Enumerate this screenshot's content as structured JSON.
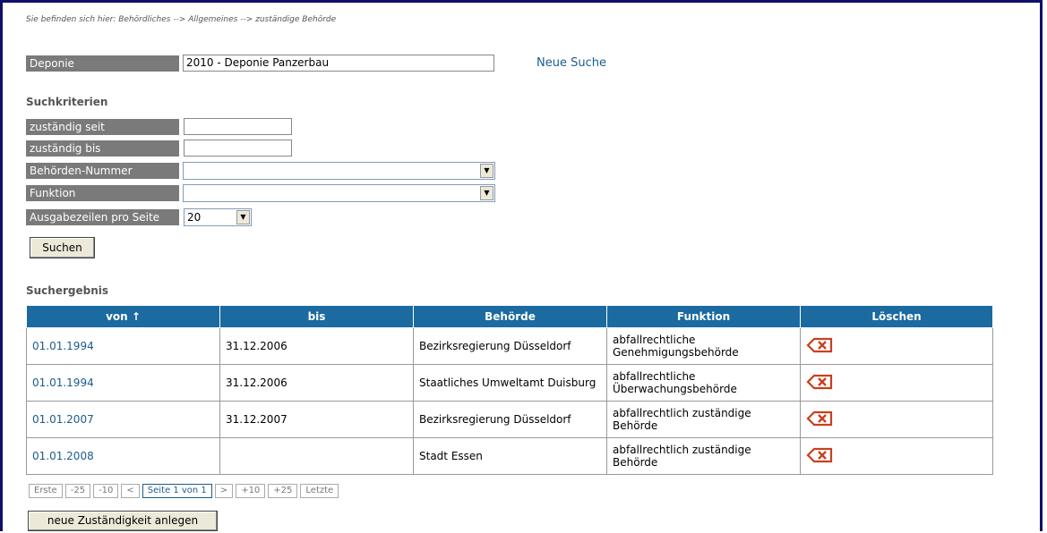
{
  "breadcrumb": "Sie befinden sich hier: Behördliches --> Allgemeines --> zuständige Behörde",
  "deponie": {
    "label": "Deponie",
    "value": "2010 - Deponie Panzerbau",
    "neue_suche": "Neue Suche"
  },
  "suchkriterien": {
    "heading": "Suchkriterien",
    "zustaendig_seit": {
      "label": "zuständig seit",
      "value": ""
    },
    "zustaendig_bis": {
      "label": "zuständig bis",
      "value": ""
    },
    "behoerden_nummer": {
      "label": "Behörden-Nummer",
      "value": ""
    },
    "funktion": {
      "label": "Funktion",
      "value": ""
    },
    "ausgabezeilen": {
      "label": "Ausgabezeilen pro Seite",
      "value": "20"
    },
    "suchen_button": "Suchen"
  },
  "suchergebnis": {
    "heading": "Suchergebnis",
    "columns": [
      "von ↑",
      "bis",
      "Behörde",
      "Funktion",
      "Löschen"
    ],
    "rows": [
      {
        "von": "01.01.1994",
        "bis": "31.12.2006",
        "behoerde": "Bezirksregierung Düsseldorf",
        "funktion": "abfallrechtliche Genehmigungsbehörde"
      },
      {
        "von": "01.01.1994",
        "bis": "31.12.2006",
        "behoerde": "Staatliches Umweltamt Duisburg",
        "funktion": "abfallrechtliche Überwachungsbehörde"
      },
      {
        "von": "01.01.2007",
        "bis": "31.12.2007",
        "behoerde": "Bezirksregierung Düsseldorf",
        "funktion": "abfallrechtlich zuständige Behörde"
      },
      {
        "von": "01.01.2008",
        "bis": "",
        "behoerde": "Stadt Essen",
        "funktion": "abfallrechtlich zuständige Behörde"
      }
    ],
    "delete_icon": "delete-icon"
  },
  "pager": {
    "first": "Erste",
    "minus25": "-25",
    "minus10": "-10",
    "prev": "<",
    "current": "Seite 1 von 1",
    "next": ">",
    "plus10": "+10",
    "plus25": "+25",
    "last": "Letzte"
  },
  "new_button": "neue Zuständigkeit anlegen",
  "colors": {
    "header_blue": "#1b6aa0",
    "label_gray": "#7a7a7a",
    "link_blue": "#1a5c8c",
    "delete_red": "#c8401e"
  }
}
